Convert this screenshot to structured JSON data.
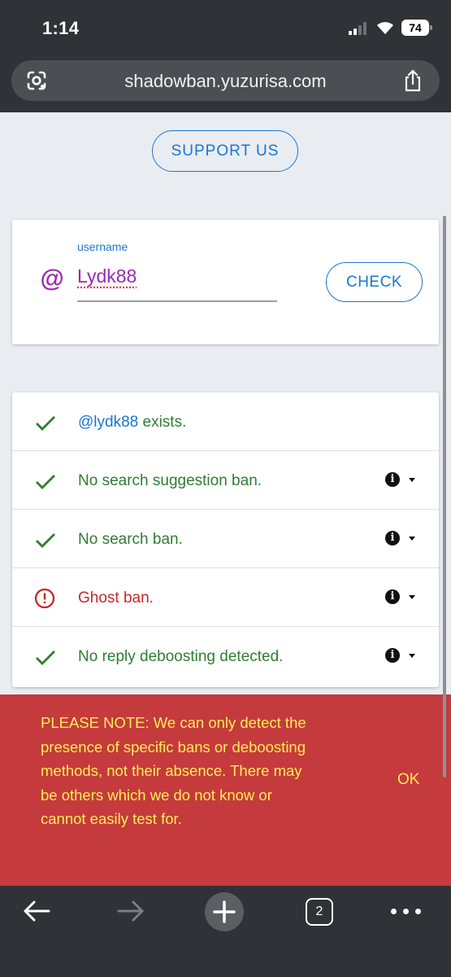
{
  "status_bar": {
    "time": "1:14",
    "battery": "74"
  },
  "browser": {
    "url": "shadowban.yuzurisa.com",
    "lens_icon": "camera-search-icon",
    "share_icon": "share-icon"
  },
  "page": {
    "support_label": "SUPPORT US",
    "form": {
      "at_symbol": "@",
      "field_label": "username",
      "field_value": "Lydk88",
      "check_label": "CHECK"
    },
    "results": [
      {
        "status": "ok",
        "handle": "@lydk88",
        "text": " exists.",
        "has_info": false
      },
      {
        "status": "ok",
        "text": "No search suggestion ban.",
        "has_info": true
      },
      {
        "status": "ok",
        "text": "No search ban.",
        "has_info": true
      },
      {
        "status": "error",
        "text": "Ghost ban.",
        "has_info": true
      },
      {
        "status": "ok",
        "text": "No reply deboosting detected.",
        "has_info": true
      }
    ],
    "notice": {
      "text": "PLEASE NOTE: We can only detect the presence of specific bans or deboosting methods, not their absence. There may be others which we do not know or cannot easily test for.",
      "ok_label": "OK"
    }
  },
  "toolbar": {
    "tab_count": "2",
    "icons": [
      "back-arrow-icon",
      "forward-arrow-icon",
      "new-tab-icon",
      "tab-switcher-icon",
      "more-icon"
    ]
  },
  "colors": {
    "ok": "#2e7d32",
    "error": "#c62828",
    "accent": "#1976d2",
    "username": "#9c27b0",
    "notice_bg": "#c53a3d",
    "notice_text": "#ffee58"
  }
}
